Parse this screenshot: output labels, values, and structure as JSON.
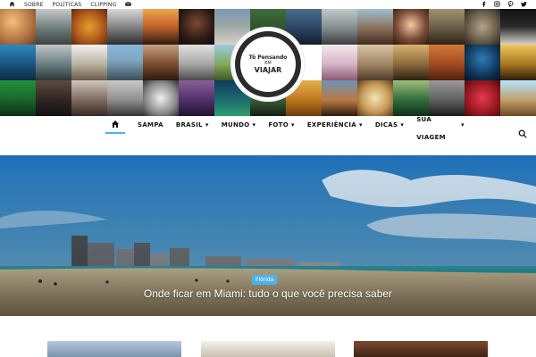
{
  "topbar": {
    "links": [
      "SOBRE",
      "POLÍTICAS",
      "CLIPPING"
    ],
    "icons": [
      "home-icon",
      "mail-icon",
      "facebook-icon",
      "instagram-icon",
      "pinterest-icon",
      "twitter-icon"
    ]
  },
  "logo": {
    "top_text": "Tô Pensando",
    "em_text": "EM",
    "bottom_text": "VIAJAR"
  },
  "nav": {
    "items": [
      {
        "label": "SAMPA",
        "has_dropdown": false
      },
      {
        "label": "BRASIL",
        "has_dropdown": true
      },
      {
        "label": "MUNDO",
        "has_dropdown": true
      },
      {
        "label": "FOTO",
        "has_dropdown": true
      },
      {
        "label": "EXPERIÊNCIA",
        "has_dropdown": true
      },
      {
        "label": "DICAS",
        "has_dropdown": true
      }
    ],
    "sua_line1": "SUA",
    "sua_line2": "VIAGEM"
  },
  "hero": {
    "badge": "Flórida",
    "title": "Onde ficar em Miami: tudo o que você precisa saber"
  },
  "colors": {
    "accent": "#4db2ec",
    "text": "#111111"
  }
}
